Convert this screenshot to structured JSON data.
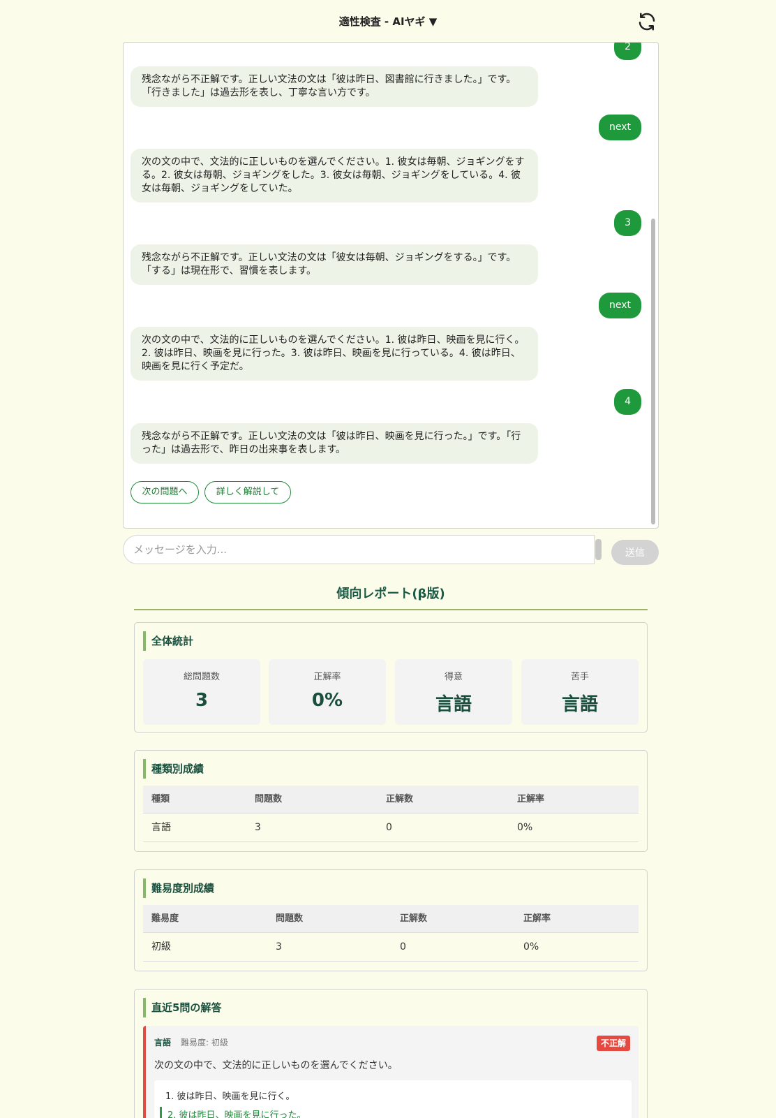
{
  "header": {
    "title": "適性検査 - AIヤギ ▼"
  },
  "chat": {
    "messages": [
      {
        "role": "user",
        "text": "2"
      },
      {
        "role": "bot",
        "text": "残念ながら不正解です。正しい文法の文は「彼は昨日、図書館に行きました。」です。「行きました」は過去形を表し、丁寧な言い方です。"
      },
      {
        "role": "user",
        "text": "next"
      },
      {
        "role": "bot",
        "text": "次の文の中で、文法的に正しいものを選んでください。1. 彼女は毎朝、ジョギングをする。2. 彼女は毎朝、ジョギングをした。3. 彼女は毎朝、ジョギングをしている。4. 彼女は毎朝、ジョギングをしていた。"
      },
      {
        "role": "user",
        "text": "3"
      },
      {
        "role": "bot",
        "text": "残念ながら不正解です。正しい文法の文は「彼女は毎朝、ジョギングをする。」です。「する」は現在形で、習慣を表します。"
      },
      {
        "role": "user",
        "text": "next"
      },
      {
        "role": "bot",
        "text": "次の文の中で、文法的に正しいものを選んでください。1. 彼は昨日、映画を見に行く。2. 彼は昨日、映画を見に行った。3. 彼は昨日、映画を見に行っている。4. 彼は昨日、映画を見に行く予定だ。"
      },
      {
        "role": "user",
        "text": "4"
      },
      {
        "role": "bot",
        "text": "残念ながら不正解です。正しい文法の文は「彼は昨日、映画を見に行った。」です。「行った」は過去形で、昨日の出来事を表します。"
      }
    ],
    "chips": [
      "次の問題へ",
      "詳しく解説して"
    ]
  },
  "input": {
    "placeholder": "メッセージを入力...",
    "send_label": "送信"
  },
  "report": {
    "title": "傾向レポート(β版)",
    "overall": {
      "heading": "全体統計",
      "stats": [
        {
          "label": "総問題数",
          "value": "3"
        },
        {
          "label": "正解率",
          "value": "0%"
        },
        {
          "label": "得意",
          "value": "言語"
        },
        {
          "label": "苦手",
          "value": "言語"
        }
      ]
    },
    "by_type": {
      "heading": "種類別成績",
      "columns": [
        "種類",
        "問題数",
        "正解数",
        "正解率"
      ],
      "rows": [
        [
          "言語",
          "3",
          "0",
          "0%"
        ]
      ]
    },
    "by_difficulty": {
      "heading": "難易度別成績",
      "columns": [
        "難易度",
        "問題数",
        "正解数",
        "正解率"
      ],
      "rows": [
        [
          "初級",
          "3",
          "0",
          "0%"
        ]
      ]
    },
    "recent": {
      "heading": "直近5問の解答",
      "items": [
        {
          "type": "言語",
          "difficulty": "難易度: 初級",
          "result": "不正解",
          "question": "次の文の中で、文法的に正しいものを選んでください。",
          "options": [
            "1. 彼は昨日、映画を見に行く。",
            "2. 彼は昨日、映画を見に行った。"
          ]
        }
      ]
    }
  },
  "colors": {
    "accent": "#1e9a3c",
    "background": "#fbfcea",
    "incorrect": "#e44a3f",
    "heading": "#1a4f3d"
  }
}
